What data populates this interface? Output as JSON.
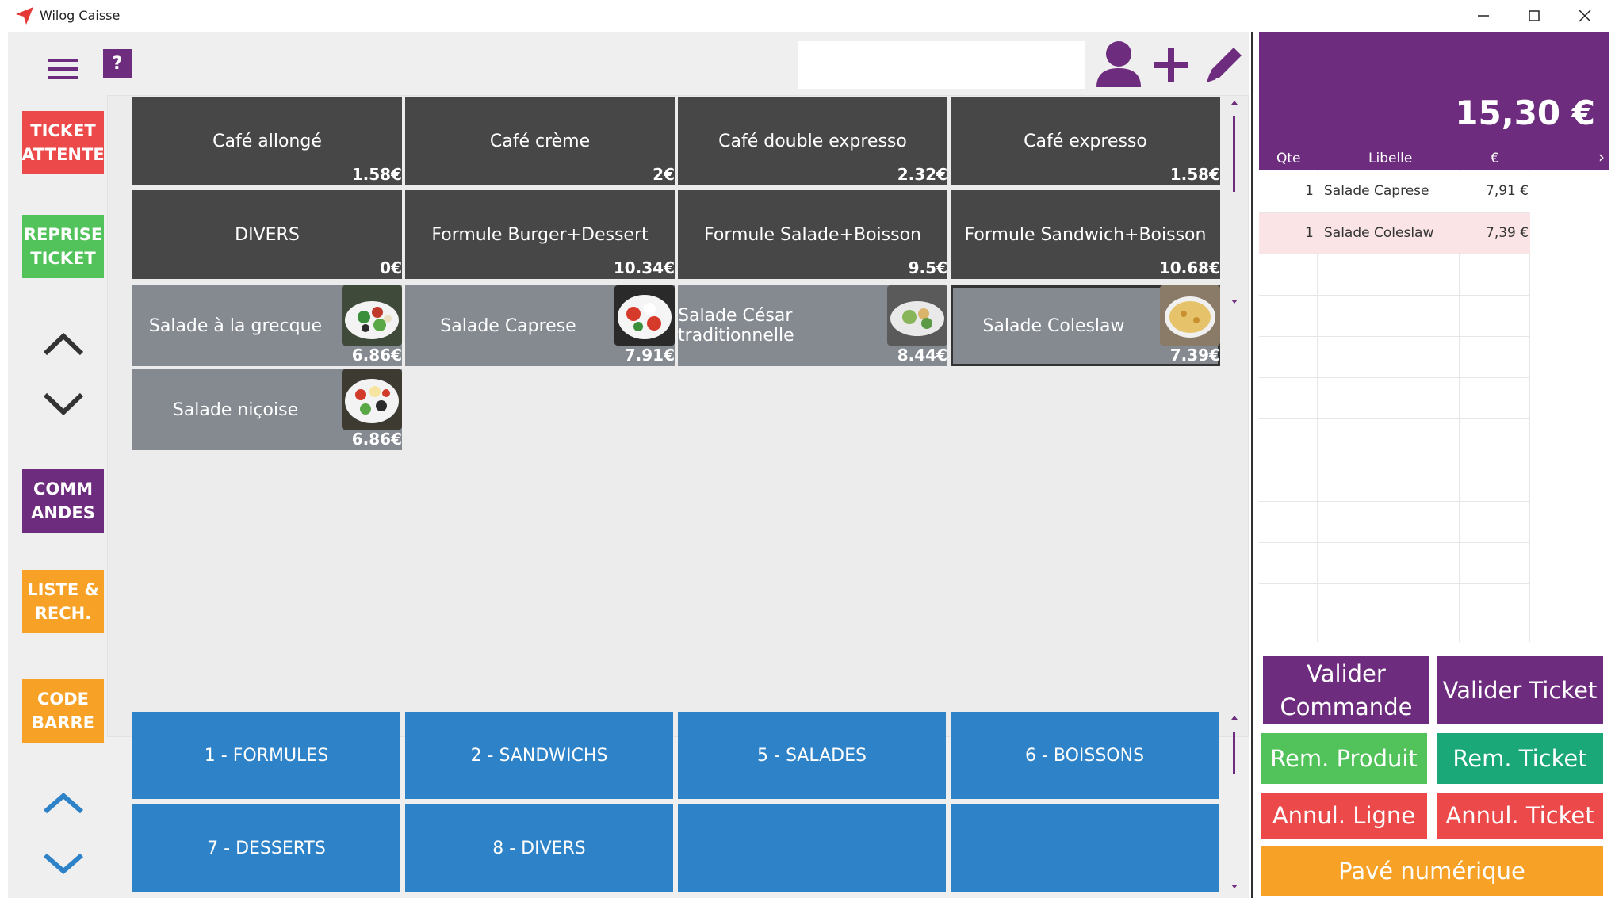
{
  "window": {
    "title": "Wilog Caisse"
  },
  "colors": {
    "purple": "#6e2c7e",
    "red": "#ec4a4a",
    "green": "#52c35b",
    "orange": "#f7a226",
    "teal": "#1aa879",
    "blue": "#2e82c8",
    "dark_tile": "#474747",
    "gray_tile": "#858a91"
  },
  "toolbar": {
    "help_label": "?",
    "search_value": ""
  },
  "side_buttons": [
    {
      "label": "TICKET\nATTENTE"
    },
    {
      "label": "REPRISE\nTICKET"
    },
    {
      "label": "COMM\nANDES"
    },
    {
      "label": "LISTE &\nRECH."
    },
    {
      "label": "CODE\nBARRE"
    }
  ],
  "products_top": [
    {
      "name": "Café allongé",
      "price": "1.58€"
    },
    {
      "name": "Café crème",
      "price": "2€"
    },
    {
      "name": "Café double expresso",
      "price": "2.32€"
    },
    {
      "name": "Café expresso",
      "price": "1.58€"
    },
    {
      "name": "DIVERS",
      "price": "0€"
    },
    {
      "name": "Formule Burger+Dessert",
      "price": "10.34€"
    },
    {
      "name": "Formule Salade+Boisson",
      "price": "9.5€"
    },
    {
      "name": "Formule Sandwich+Boisson",
      "price": "10.68€"
    }
  ],
  "products_salades": [
    {
      "name": "Salade à la grecque",
      "price": "6.86€"
    },
    {
      "name": "Salade Caprese",
      "price": "7.91€"
    },
    {
      "name": "Salade César traditionnelle",
      "price": "8.44€"
    },
    {
      "name": "Salade Coleslaw",
      "price": "7.39€"
    },
    {
      "name": "Salade niçoise",
      "price": "6.86€"
    }
  ],
  "categories": [
    {
      "label": "1 - FORMULES"
    },
    {
      "label": "2 - SANDWICHS"
    },
    {
      "label": "5 - SALADES"
    },
    {
      "label": "6 - BOISSONS"
    },
    {
      "label": "7 - DESSERTS"
    },
    {
      "label": "8 - DIVERS"
    },
    {
      "label": ""
    },
    {
      "label": ""
    }
  ],
  "ticket": {
    "total": "15,30 €",
    "columns": {
      "qty": "Qte",
      "label": "Libelle",
      "price": "€",
      "more": "›"
    },
    "lines": [
      {
        "qty": "1",
        "label": "Salade Caprese",
        "price": "7,91 €"
      },
      {
        "qty": "1",
        "label": "Salade Coleslaw",
        "price": "7,39 €"
      }
    ]
  },
  "actions": {
    "valider_commande": "Valider\nCommande",
    "valider_ticket": "Valider Ticket",
    "rem_produit": "Rem. Produit",
    "rem_ticket": "Rem. Ticket",
    "annul_ligne": "Annul. Ligne",
    "annul_ticket": "Annul. Ticket",
    "pave": "Pavé numérique"
  }
}
